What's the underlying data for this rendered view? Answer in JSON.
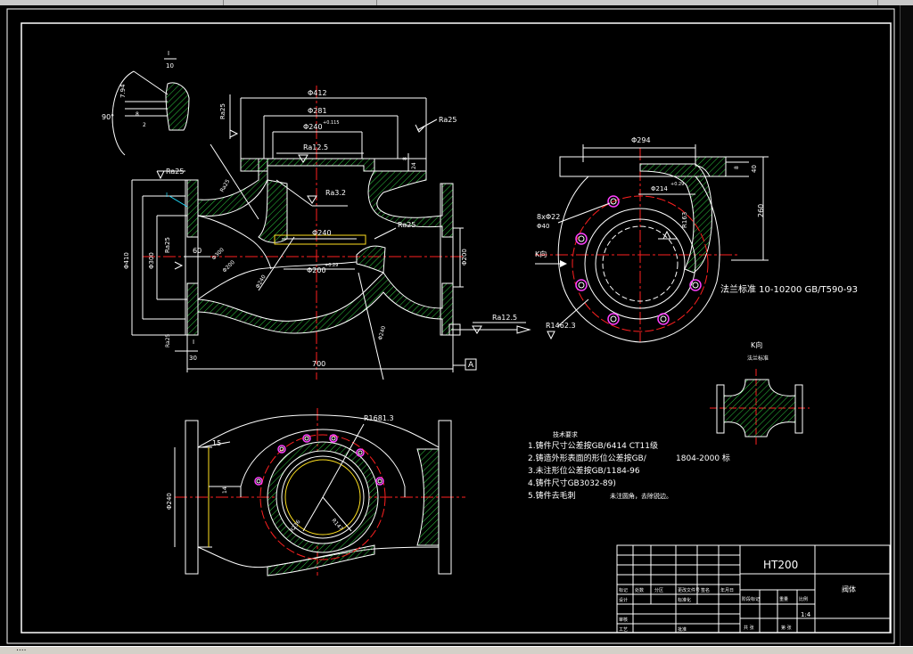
{
  "window": {
    "status_text": "...."
  },
  "drawing": {
    "dim_phi412": "Φ412",
    "dim_phi281": "Φ281",
    "dim_phi240_top": "Φ240",
    "dim_phi240_top_tol": "+0.115",
    "rough_top": "Ra12.5",
    "rough_ra32": "Ra3.2",
    "rough_ra25_left": "Ra25",
    "rough_ra25_top": "Ra25",
    "rough_ra25_mid": "Ra25",
    "rough_ra25_right": "Ra12.5",
    "rough_r025": "Ra25",
    "dim_phi240_mid": "Φ240",
    "dim_phi200_mid": "Φ200",
    "dim_phi200_tol": "+0.29",
    "dim_len60": "60",
    "dim_len700": "700",
    "dim_len30": "30",
    "dim_len24": "24",
    "dim_len8": "8",
    "dim_phi410": "Φ410",
    "dim_phi300": "Φ300",
    "dim_phi200_r": "Φ200",
    "datum_a": "A",
    "detail_label_top": "I",
    "detail_label_bot": "10",
    "detail_90": "90°",
    "detail_794": "7.94",
    "detail_8": "8",
    "detail_2": "2",
    "side_phi294": "Φ294",
    "side_phi214": "Φ214",
    "side_phi214_tol": "+0.29",
    "side_r163": "R163",
    "side_8phi22": "8xΦ22",
    "side_phi40": "Φ40",
    "side_k": "K向",
    "side_r1462": "R1462.3",
    "side_8": "8",
    "side_40": "40",
    "side_260": "260",
    "side_std": "法兰标准 10-10200 GB/T590-93",
    "view_k": "K向",
    "view_k_sub": "法兰标准",
    "bottom_r1681": "R1681.3",
    "bottom_15": "15",
    "bottom_14": "14",
    "bottom_phi240": "Φ240",
    "bottom_r236": "R236",
    "bottom_r147": "R147",
    "notes_title": "技术要求",
    "note1_a": "1.铸件尺寸公差按GB/",
    "note1_b": "6414 CT11级",
    "note2_a": "2.铸造外形表面的形位公差按GB/",
    "note2_b": "1804-2000 标",
    "note3_a": "3.未注形位公差按GB/",
    "note3_b": "1184-96",
    "note4": "4.铸件尺寸GB3032-89)",
    "note5_a": "5.铸件去毛刺",
    "note5_b": "未注圆角，去除锐边。",
    "tb_material": "HT200",
    "tb_name": "阀体",
    "tb_ratio": "1:4",
    "tb_cells": [
      "标记",
      "处数",
      "分区",
      "更改文件号",
      "签名",
      "年月日",
      "设计",
      "标准化",
      "阶段标记",
      "重量",
      "比例",
      "审核",
      "工艺",
      "批准",
      "共 张",
      "第 张"
    ]
  },
  "colors": {
    "bg": "#000000",
    "outline": "#ffffff",
    "hatch": "#2ecc40",
    "center": "#ff2020",
    "yellow": "#ffe020",
    "magenta": "#ff40ff",
    "cyan": "#20e0ff"
  }
}
